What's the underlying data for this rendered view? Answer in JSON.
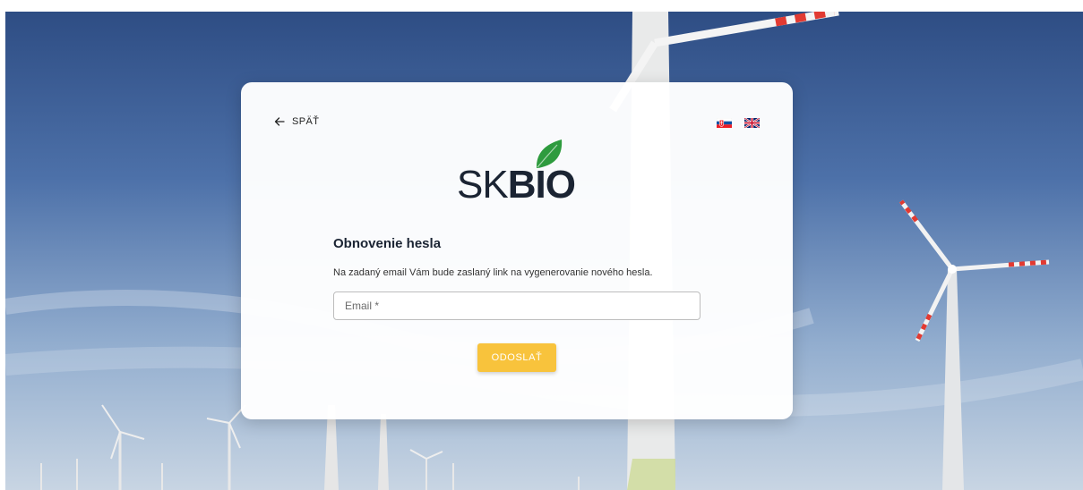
{
  "nav": {
    "back_label": "SPÄŤ",
    "back_icon": "arrow-left-icon"
  },
  "languages": [
    {
      "code": "sk",
      "icon": "flag-sk-icon"
    },
    {
      "code": "en",
      "icon": "flag-gb-icon"
    }
  ],
  "logo": {
    "part1": "SK",
    "part2": "BIO",
    "leaf_icon": "leaf-icon"
  },
  "form": {
    "title": "Obnovenie hesla",
    "description": "Na zadaný email Vám bude zaslaný link na vygenerovanie nového hesla.",
    "email_label": "Email *",
    "email_value": "",
    "submit_label": "ODOSLAŤ"
  },
  "colors": {
    "accent": "#f8c33c",
    "brand_green": "#2e9b3e",
    "text_dark": "#1b2433"
  }
}
